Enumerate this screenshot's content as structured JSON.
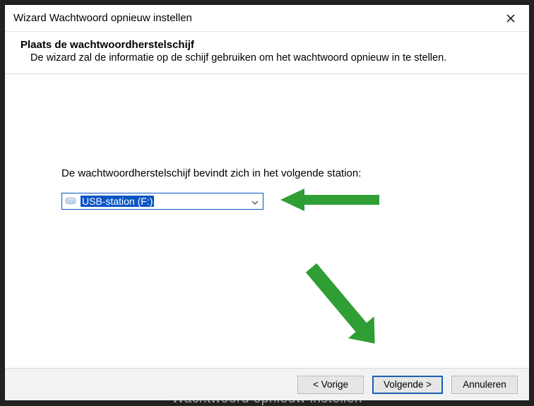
{
  "titlebar": {
    "title": "Wizard Wachtwoord opnieuw instellen",
    "close_name": "close-icon"
  },
  "header": {
    "title": "Plaats de wachtwoordherstelschijf",
    "subtitle": "De wizard zal de informatie op de schijf gebruiken om het wachtwoord opnieuw in te stellen."
  },
  "body": {
    "prompt": "De wachtwoordherstelschijf bevindt zich in het volgende station:",
    "drive_selected": "USB-station (F:)"
  },
  "footer": {
    "back": "< Vorige",
    "next": "Volgende >",
    "cancel": "Annuleren"
  },
  "backdrop_hint": "Wachtwoord opnieuw instellen",
  "annotations": {
    "arrow_to_combo": "green-arrow-horizontal",
    "arrow_to_next": "green-arrow-diagonal"
  },
  "colors": {
    "accent": "#0a55c4",
    "arrow": "#2f9e34"
  }
}
